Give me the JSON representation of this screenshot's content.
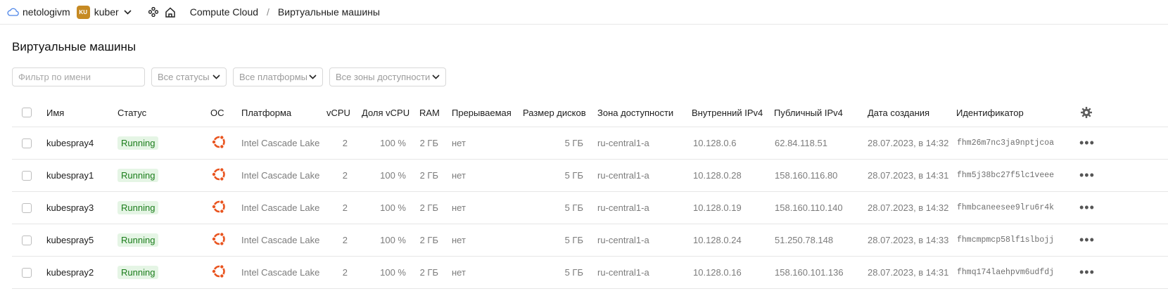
{
  "topbar": {
    "org_name": "netologivm",
    "folder_badge": "KU",
    "folder_name": "kuber",
    "service": "Compute Cloud",
    "separator": "/",
    "page": "Виртуальные машины"
  },
  "title": "Виртуальные машины",
  "filters": {
    "name_placeholder": "Фильтр по имени",
    "status": "Все статусы",
    "platform": "Все платформы",
    "zone": "Все зоны доступности"
  },
  "table": {
    "columns": {
      "name": "Имя",
      "status": "Статус",
      "os": "ОС",
      "platform": "Платформа",
      "vcpu": "vCPU",
      "share": "Доля vCPU",
      "ram": "RAM",
      "preemptible": "Прерываемая",
      "disk": "Размер дисков",
      "zone": "Зона доступности",
      "internal_ip": "Внутренний IPv4",
      "public_ip": "Публичный IPv4",
      "created": "Дата создания",
      "id": "Идентификатор"
    },
    "rows": [
      {
        "name": "kubespray4",
        "status": "Running",
        "os_icon": "ubuntu-icon",
        "platform": "Intel Cascade Lake",
        "vcpu": "2",
        "share": "100 %",
        "ram": "2 ГБ",
        "preemptible": "нет",
        "disk": "5 ГБ",
        "zone": "ru-central1-a",
        "internal_ip": "10.128.0.6",
        "public_ip": "62.84.118.51",
        "created": "28.07.2023, в 14:32",
        "id": "fhm26m7nc3ja9nptjcoa"
      },
      {
        "name": "kubespray1",
        "status": "Running",
        "os_icon": "ubuntu-icon",
        "platform": "Intel Cascade Lake",
        "vcpu": "2",
        "share": "100 %",
        "ram": "2 ГБ",
        "preemptible": "нет",
        "disk": "5 ГБ",
        "zone": "ru-central1-a",
        "internal_ip": "10.128.0.28",
        "public_ip": "158.160.116.80",
        "created": "28.07.2023, в 14:31",
        "id": "fhm5j38bc27f5lc1veee"
      },
      {
        "name": "kubespray3",
        "status": "Running",
        "os_icon": "ubuntu-icon",
        "platform": "Intel Cascade Lake",
        "vcpu": "2",
        "share": "100 %",
        "ram": "2 ГБ",
        "preemptible": "нет",
        "disk": "5 ГБ",
        "zone": "ru-central1-a",
        "internal_ip": "10.128.0.19",
        "public_ip": "158.160.110.140",
        "created": "28.07.2023, в 14:32",
        "id": "fhmbcaneesee9lru6r4k"
      },
      {
        "name": "kubespray5",
        "status": "Running",
        "os_icon": "ubuntu-icon",
        "platform": "Intel Cascade Lake",
        "vcpu": "2",
        "share": "100 %",
        "ram": "2 ГБ",
        "preemptible": "нет",
        "disk": "5 ГБ",
        "zone": "ru-central1-a",
        "internal_ip": "10.128.0.24",
        "public_ip": "51.250.78.148",
        "created": "28.07.2023, в 14:33",
        "id": "fhmcmpmcp58lf1slbojj"
      },
      {
        "name": "kubespray2",
        "status": "Running",
        "os_icon": "ubuntu-icon",
        "platform": "Intel Cascade Lake",
        "vcpu": "2",
        "share": "100 %",
        "ram": "2 ГБ",
        "preemptible": "нет",
        "disk": "5 ГБ",
        "zone": "ru-central1-a",
        "internal_ip": "10.128.0.16",
        "public_ip": "158.160.101.136",
        "created": "28.07.2023, в 14:31",
        "id": "fhmq174laehpvm6udfdj"
      }
    ]
  },
  "colors": {
    "status_running_bg": "#e5f5e5",
    "status_running_text": "#1b7d1b",
    "ubuntu": "#e9541f",
    "folder_badge": "#c68a23"
  }
}
